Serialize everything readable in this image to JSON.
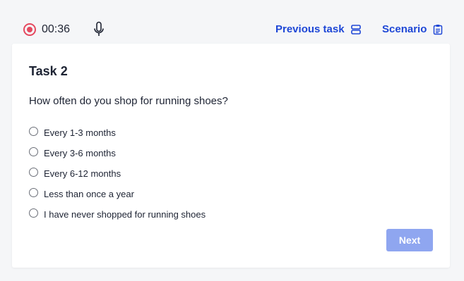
{
  "recording": {
    "timer": "00:36",
    "record_color": "#e5495f"
  },
  "header": {
    "previous_task_label": "Previous task",
    "previous_task_icon": "layers-icon",
    "scenario_label": "Scenario",
    "scenario_icon": "clipboard-icon",
    "link_color": "#1e47d6"
  },
  "task": {
    "title": "Task 2",
    "question": "How often do you shop for running shoes?",
    "options": [
      {
        "label": "Every 1-3 months",
        "selected": false
      },
      {
        "label": "Every 3-6 months",
        "selected": false
      },
      {
        "label": "Every 6-12 months",
        "selected": false
      },
      {
        "label": "Less than once a year",
        "selected": false
      },
      {
        "label": "I have never shopped for running shoes",
        "selected": false
      }
    ],
    "next_label": "Next",
    "next_disabled_color": "#8fa6f0"
  }
}
